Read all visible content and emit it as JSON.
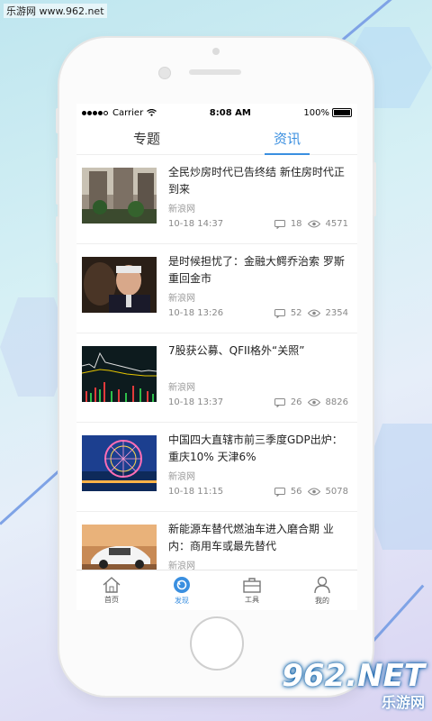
{
  "watermark": {
    "site": "乐游网 www.962.net",
    "logo_big": "962.NET",
    "logo_small": "乐游网"
  },
  "status_bar": {
    "carrier": "Carrier",
    "time": "8:08 AM",
    "battery": "100%"
  },
  "tabs": [
    {
      "label": "专题",
      "active": false
    },
    {
      "label": "资讯",
      "active": true
    }
  ],
  "news": [
    {
      "title": "全民炒房时代已告终结 新住房时代正到来",
      "source": "新浪网",
      "time": "10-18 14:37",
      "comments": "18",
      "views": "4571",
      "thumb": "building"
    },
    {
      "title": "是时候担忧了：金融大鳄乔治索 罗斯重回金市",
      "source": "新浪网",
      "time": "10-18 13:26",
      "comments": "52",
      "views": "2354",
      "thumb": "portrait"
    },
    {
      "title": "7股获公募、QFII格外“关照”",
      "source": "新浪网",
      "time": "10-18 13:37",
      "comments": "26",
      "views": "8826",
      "thumb": "stock-chart"
    },
    {
      "title": "中国四大直辖市前三季度GDP出炉：重庆10% 天津6%",
      "source": "新浪网",
      "time": "10-18 11:15",
      "comments": "56",
      "views": "5078",
      "thumb": "ferris-wheel"
    },
    {
      "title": "新能源车替代燃油车进入磨合期 业内：商用车或最先替代",
      "source": "新浪网",
      "time": "",
      "comments": "",
      "views": "",
      "thumb": "car"
    }
  ],
  "bottom_nav": [
    {
      "label": "首页",
      "icon": "home-icon",
      "active": false
    },
    {
      "label": "发现",
      "icon": "discover-icon",
      "active": true
    },
    {
      "label": "工具",
      "icon": "toolbox-icon",
      "active": false
    },
    {
      "label": "我的",
      "icon": "user-icon",
      "active": false
    }
  ],
  "colors": {
    "accent": "#3a8fe0",
    "text": "#222222",
    "muted": "#888888"
  }
}
